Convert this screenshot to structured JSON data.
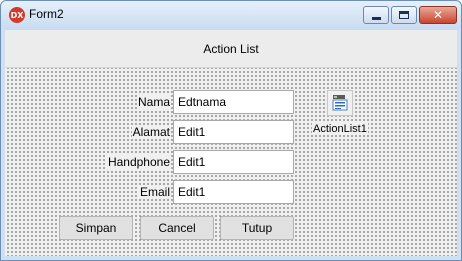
{
  "window": {
    "title": "Form2",
    "icon_label": "DX",
    "controls": [
      "minimize-icon",
      "maximize-icon",
      "close-icon"
    ]
  },
  "header": {
    "title": "Action List"
  },
  "fields": [
    {
      "label": "Nama",
      "value": "Edtnama"
    },
    {
      "label": "Alamat",
      "value": "Edit1"
    },
    {
      "label": "Handphone",
      "value": "Edit1"
    },
    {
      "label": "Email",
      "value": "Edit1"
    }
  ],
  "buttons": {
    "save": "Simpan",
    "cancel": "Cancel",
    "close": "Tutup"
  },
  "component": {
    "icon": "action-list-icon",
    "label": "ActionList1"
  },
  "colors": {
    "title_bar": "#c9dcf1",
    "close_button": "#c8452e",
    "form_background": "#f0f0f0"
  }
}
